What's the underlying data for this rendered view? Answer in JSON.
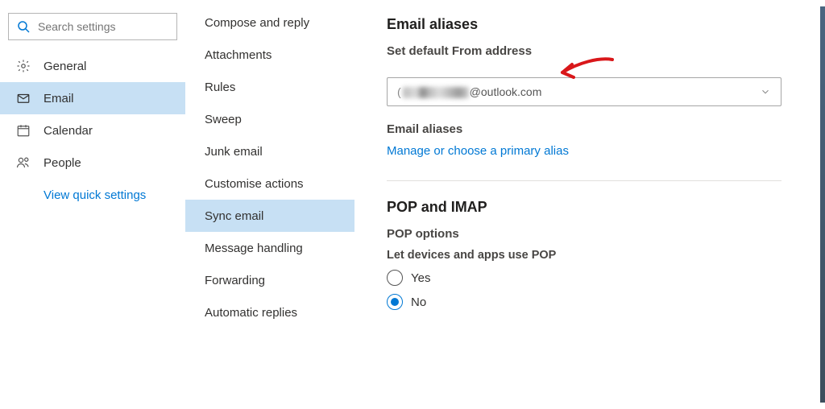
{
  "search": {
    "placeholder": "Search settings"
  },
  "left_nav": {
    "general": {
      "label": "General"
    },
    "email": {
      "label": "Email"
    },
    "calendar": {
      "label": "Calendar"
    },
    "people": {
      "label": "People"
    },
    "quick": {
      "label": "View quick settings"
    }
  },
  "sub_nav": [
    "Compose and reply",
    "Attachments",
    "Rules",
    "Sweep",
    "Junk email",
    "Customise actions",
    "Sync email",
    "Message handling",
    "Forwarding",
    "Automatic replies"
  ],
  "sub_nav_selected_index": 6,
  "main": {
    "aliases_header": "Email aliases",
    "set_default_label": "Set default From address",
    "from_value_suffix": "@outlook.com",
    "aliases_sub": "Email aliases",
    "manage_link": "Manage or choose a primary alias",
    "pop_header": "POP and IMAP",
    "pop_options": "POP options",
    "pop_let_label": "Let devices and apps use POP",
    "yes": "Yes",
    "no": "No",
    "pop_selected": "no"
  }
}
